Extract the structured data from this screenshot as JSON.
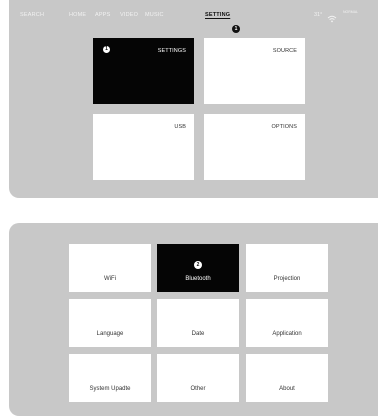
{
  "nav": {
    "items": [
      "SEARCH",
      "HOME",
      "APPS",
      "VIDEO",
      "MUSIC",
      "SETTING"
    ],
    "active_index": 5,
    "marker": "1"
  },
  "status": {
    "temperature": "31°",
    "wifi_icon": "wifi-icon",
    "extra": "NORMAL"
  },
  "settings_menu": {
    "tiles": [
      {
        "label": "SETTINGS",
        "badge": "1",
        "selected": true
      },
      {
        "label": "SOURCE",
        "selected": false
      },
      {
        "label": "USB",
        "selected": false
      },
      {
        "label": "OPTIONS",
        "selected": false
      }
    ]
  },
  "settings_grid": {
    "tiles": [
      {
        "label": "WiFi",
        "selected": false
      },
      {
        "label": "Bluetooth",
        "badge": "2",
        "selected": true
      },
      {
        "label": "Projection",
        "selected": false
      },
      {
        "label": "Language",
        "selected": false
      },
      {
        "label": "Date",
        "selected": false
      },
      {
        "label": "Application",
        "selected": false
      },
      {
        "label": "System Upadte",
        "selected": false
      },
      {
        "label": "Other",
        "selected": false
      },
      {
        "label": "About",
        "selected": false
      }
    ]
  },
  "colors": {
    "panel": "#c8c8c8",
    "tile": "#ffffff",
    "selected": "#050505"
  }
}
